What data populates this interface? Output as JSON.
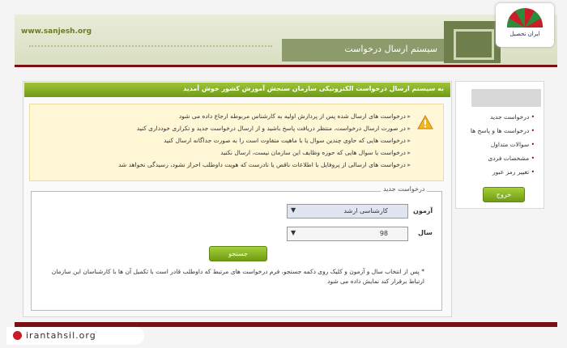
{
  "header": {
    "site_url": "www.sanjesh.org",
    "title": "سیستم ارسال درخواست"
  },
  "logo": {
    "text": "ایران تحصیل"
  },
  "welcome": "به سیستم ارسال درخواست الکترونیکی سازمان سنجش آموزش کشور خوش آمدید",
  "notices": [
    "درخواست های ارسال شده پس از پردازش اولیه به کارشناس مربوطه ارجاع داده می شود",
    "در صورت ارسال درخواست، منتظر دریافت پاسخ باشید و از ارسال درخواست جدید و تکراری خودداری کنید",
    "درخواست هایی که حاوی چندین سوال یا با ماهیت متفاوت است را به صورت جداگانه ارسال کنید",
    "درخواست یا سوال هایی که حوزه وظایف این سازمان نیست، ارسال نکنید",
    "درخواست های ارسالی از پروفایل با اطلاعات ناقص یا نادرست که هویت داوطلب احراز نشود، رسیدگی نخواهد شد"
  ],
  "form": {
    "legend": "درخواست جدید",
    "exam_label": "آزمون",
    "exam_value": "کارشناسی ارشد",
    "year_label": "سال",
    "year_value": "98",
    "search_label": "جستجو",
    "note": "* پس از انتخاب سال و آزمون و کلیک روی دکمه جستجو، فرم درخواست های مرتبط که داوطلب قادر است با تکمیل آن ها با کارشناسان این سازمان ارتباط برقرار کند نمایش داده می شود"
  },
  "sidebar": {
    "items": [
      "درخواست جدید",
      "درخواست ها و پاسخ ها",
      "سوالات متداول",
      "مشخصات فردی",
      "تغییر رمز عبور"
    ],
    "logout_label": "خروج"
  },
  "watermark": "irantahsil.org",
  "colors": {
    "accent_green": "#7fab1f",
    "brand_maroon": "#7a0f14",
    "notice_bg": "#fff7d6"
  }
}
